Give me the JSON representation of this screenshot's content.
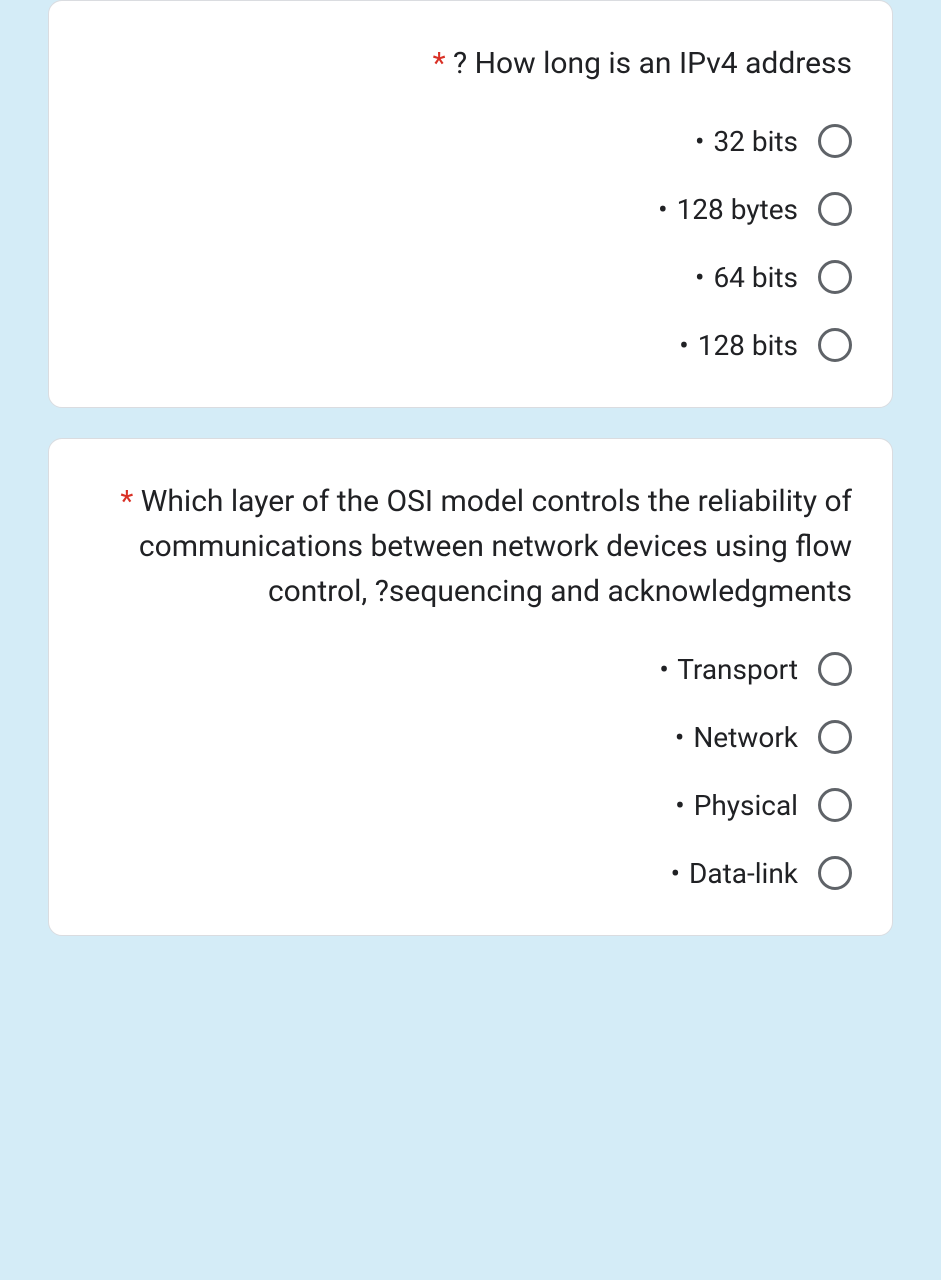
{
  "required_marker": "*",
  "bullet": "•",
  "questions": [
    {
      "text": "? How long is an IPv4 address",
      "options": [
        "32 bits",
        "128 bytes",
        "64 bits",
        "128 bits"
      ]
    },
    {
      "text": "Which layer of the OSI model controls the reliability of communications between network devices using flow control, ?sequencing and acknowledgments",
      "options": [
        "Transport",
        "Network",
        "Physical",
        "Data-link"
      ]
    }
  ]
}
